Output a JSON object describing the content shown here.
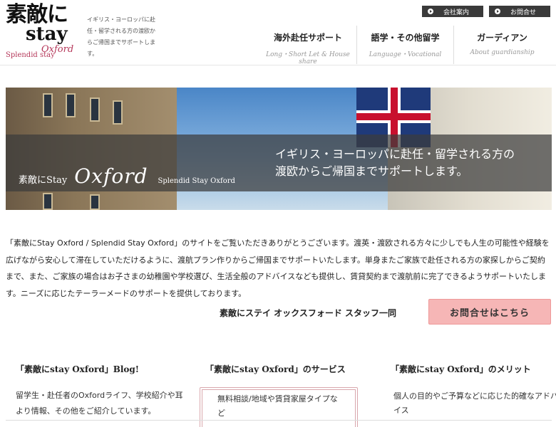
{
  "brand": {
    "logo_main": "素敵に",
    "logo_stay": "stay",
    "logo_splendid": "Splendid stay",
    "logo_oxford": "Oxford",
    "tagline": "イギリス・ヨーロッパに赴任・留学される方の渡欧からご帰国までサポートします。"
  },
  "top_buttons": [
    {
      "label": "会社案内"
    },
    {
      "label": "お問合せ"
    }
  ],
  "nav": [
    {
      "jp": "海外赴任サポート",
      "en": "Long・Short Let & House share"
    },
    {
      "jp": "語学・その他留学",
      "en": "Language・Vocational"
    },
    {
      "jp": "ガーディアン",
      "en": "About guardianship"
    }
  ],
  "hero": {
    "brand_jp": "素敵にStay",
    "brand_oxford": "Oxford",
    "brand_en": "Splendid Stay Oxford",
    "message_line1": "イギリス・ヨーロッパに赴任・留学される方の",
    "message_line2": "渡欧からご帰国までサポートします。"
  },
  "intro": {
    "text": "「素敵にStay Oxford / Splendid Stay Oxford」のサイトをご覧いただきありがとうございます。渡英・渡欧される方々に少しでも人生の可能性や経験を広げながら安心して滞在していただけるように、渡航プラン作りからご帰国までサポートいたします。単身またご家族で赴任される方の家探しからご契約まで、また、ご家族の場合はお子さまの幼稚園や学校選び、生活全般のアドバイスなども提供し、賃貸契約まで渡航前に完了できるようサポートいたします。ニーズに応じたテーラーメードのサポートを提供しております。",
    "signature": "素敵にステイ オックスフォード スタッフ一同",
    "contact_button": "お問合せはこちら"
  },
  "columns": [
    {
      "title": "「素敵にstay Oxford」Blog!",
      "body": "留学生・赴任者のOxfordライフ、学校紹介や耳より情報、その他をご紹介しています。"
    },
    {
      "title": "「素敵にstay Oxford」のサービス",
      "body": "無料相談/地域や賃貸家屋タイプなど"
    },
    {
      "title": "「素敵にstay Oxford」のメリット",
      "body": "個人の目的やご予算などに応じた的確なアドバイス"
    }
  ],
  "colors": {
    "accent_pink": "#f6b6b6",
    "brand_red": "#b5385a",
    "dark_button": "#3a3a3a"
  }
}
